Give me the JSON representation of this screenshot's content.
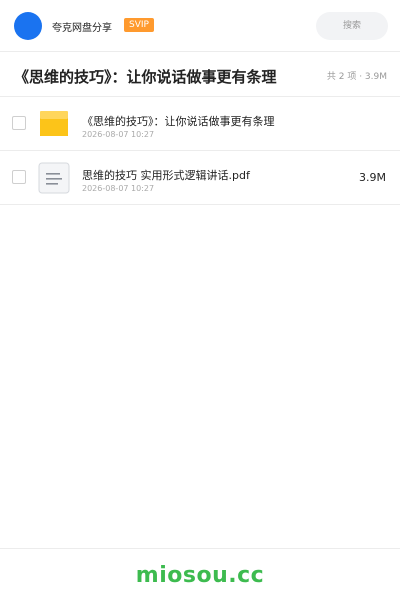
{
  "header": {
    "username": "夸克网盘分享",
    "badge": "SVIP",
    "search_placeholder": "搜索",
    "avatar_color": "#1a73f0",
    "badge_color": "#ff9a2e"
  },
  "folder": {
    "title": "《思维的技巧》：让你说话做事更有条理",
    "summary": "共 2 项 · 3.9M"
  },
  "files": [
    {
      "icon": "folder-icon",
      "name": "《思维的技巧》：让你说话做事更有条理",
      "date": "2026-08-07 10:27",
      "size": ""
    },
    {
      "icon": "document-icon",
      "name": "思维的技巧 实用形式逻辑讲话.pdf",
      "date": "2026-08-07 10:27",
      "size": "3.9M"
    }
  ],
  "footer": {
    "brand": "miosou.cc",
    "brand_color": "#3dbb4f"
  }
}
